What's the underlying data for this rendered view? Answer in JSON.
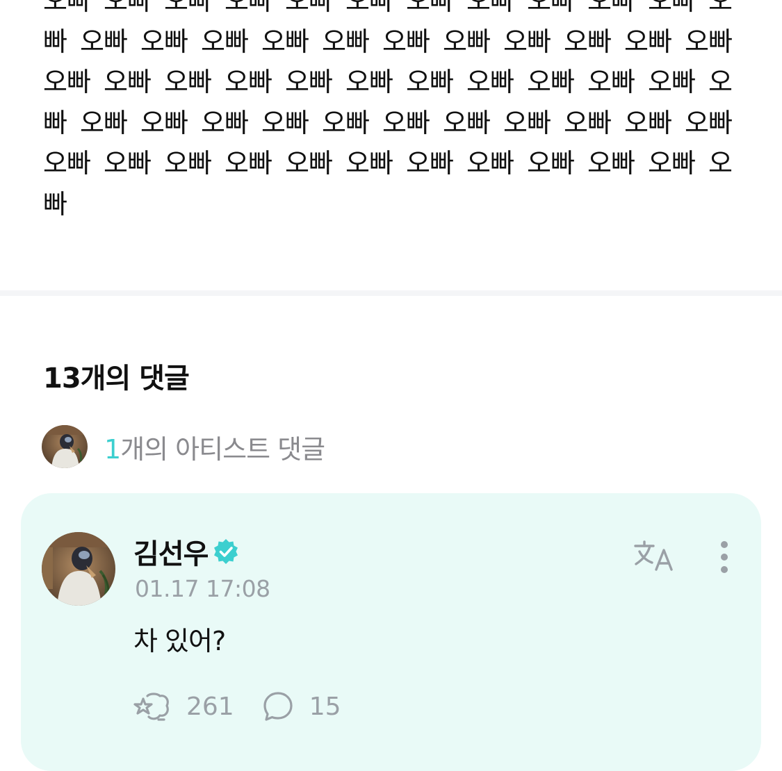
{
  "post": {
    "body_text": "오빠 오빠 오빠 오빠 오빠 오빠 오빠 오빠 오빠 오빠 오빠 오빠 오빠 오빠 오빠 오빠 오빠 오빠 오빠 오빠 오빠 오빠 오빠 오빠 오빠 오빠 오빠 오빠 오빠 오빠 오빠 오빠 오빠 오빠 오빠 오빠 오빠 오빠 오빠 오빠 오빠 오빠 오빠 오빠 오빠 오빠 오빠 오빠 오빠 오빠 오빠 오빠 오빠 오빠 오빠 오빠 오빠 오빠"
  },
  "comments": {
    "title": "13개의 댓글",
    "artist_summary": {
      "count": "1",
      "label": "개의 아티스트 댓글"
    },
    "items": [
      {
        "author": "김선우",
        "verified": true,
        "timestamp": "01.17 17:08",
        "text": "차 있어?",
        "likes": "261",
        "replies": "15"
      }
    ]
  },
  "icons": {
    "verified": "verified-badge-icon",
    "translate": "translate-icon",
    "more": "more-vertical-icon",
    "like": "like-reaction-icon",
    "reply": "reply-bubble-icon"
  },
  "colors": {
    "accent": "#3ccfcf",
    "card_background": "#e9faf7",
    "muted_text": "#9aa0a6",
    "divider": "#f4f5f7"
  }
}
